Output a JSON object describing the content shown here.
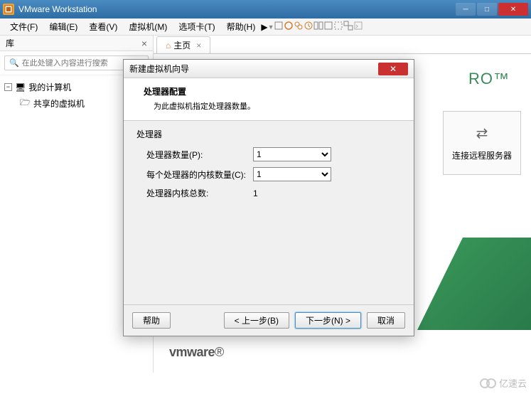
{
  "app": {
    "title": "VMware Workstation",
    "logo_text": "vmware",
    "pro_badge": "RO™"
  },
  "menu": {
    "file": "文件(F)",
    "edit": "编辑(E)",
    "view": "查看(V)",
    "vm": "虚拟机(M)",
    "tabs": "选项卡(T)",
    "help": "帮助(H)"
  },
  "sidebar": {
    "title": "库",
    "search_placeholder": "在此处键入内容进行搜索",
    "items": [
      {
        "label": "我的计算机",
        "icon": "computer"
      },
      {
        "label": "共享的虚拟机",
        "icon": "shared"
      }
    ]
  },
  "tabs": {
    "home": "主页"
  },
  "card": {
    "label": "连接远程服务器"
  },
  "dialog": {
    "title": "新建虚拟机向导",
    "heading": "处理器配置",
    "subheading": "为此虚拟机指定处理器数量。",
    "group_label": "处理器",
    "rows": {
      "processors_label": "处理器数量(P):",
      "processors_value": "1",
      "cores_label": "每个处理器的内核数量(C):",
      "cores_value": "1",
      "total_label": "处理器内核总数:",
      "total_value": "1"
    },
    "buttons": {
      "help": "帮助",
      "back": "< 上一步(B)",
      "next": "下一步(N) >",
      "cancel": "取消"
    }
  },
  "watermark": "亿速云"
}
